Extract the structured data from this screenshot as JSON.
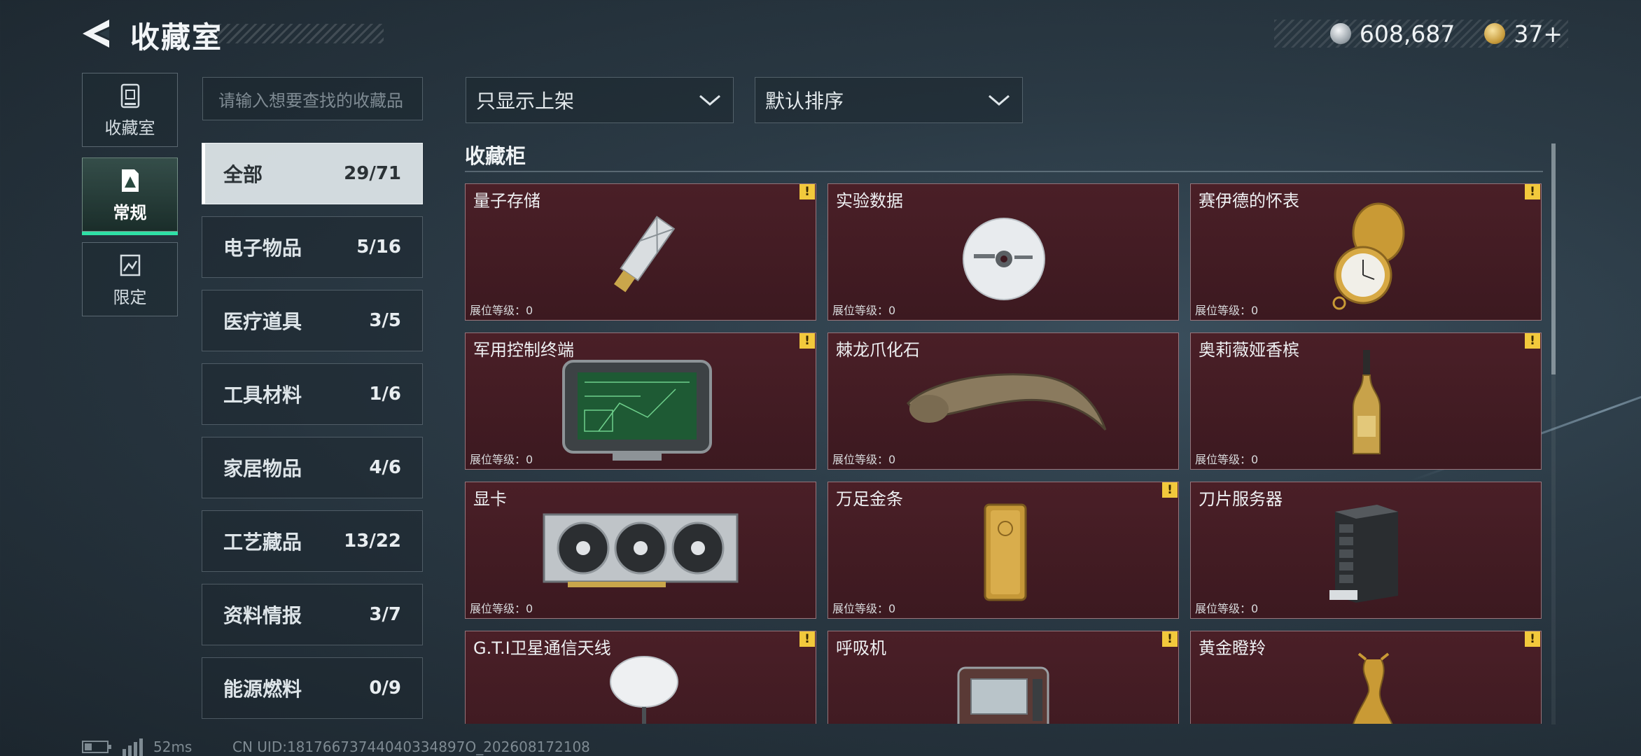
{
  "header": {
    "title": "收藏室"
  },
  "currency": {
    "silver": "608,687",
    "gold": "37+"
  },
  "nav": [
    {
      "label": "收藏室",
      "icon": "collection-room-icon"
    },
    {
      "label": "常规",
      "icon": "regular-icon",
      "active": true
    },
    {
      "label": "限定",
      "icon": "limited-icon"
    }
  ],
  "search": {
    "placeholder": "请输入想要查找的收藏品"
  },
  "filters": {
    "shelf_filter": "只显示上架",
    "sort": "默认排序"
  },
  "categories": [
    {
      "name": "全部",
      "count": "29/71",
      "active": true
    },
    {
      "name": "电子物品",
      "count": "5/16"
    },
    {
      "name": "医疗道具",
      "count": "3/5"
    },
    {
      "name": "工具材料",
      "count": "1/6"
    },
    {
      "name": "家居物品",
      "count": "4/6"
    },
    {
      "name": "工艺藏品",
      "count": "13/22"
    },
    {
      "name": "资料情报",
      "count": "3/7"
    },
    {
      "name": "能源燃料",
      "count": "0/9"
    }
  ],
  "cabinet": {
    "title": "收藏柜",
    "items": [
      {
        "name": "量子存储",
        "level": "展位等级：0",
        "warn": "!",
        "icon": "usb-storage-icon"
      },
      {
        "name": "实验数据",
        "level": "展位等级：0",
        "warn": "",
        "icon": "disc-icon"
      },
      {
        "name": "赛伊德的怀表",
        "level": "展位等级：0",
        "warn": "!",
        "icon": "pocket-watch-icon"
      },
      {
        "name": "军用控制终端",
        "level": "展位等级：0",
        "warn": "!",
        "icon": "control-terminal-icon"
      },
      {
        "name": "棘龙爪化石",
        "level": "展位等级：0",
        "warn": "",
        "icon": "claw-fossil-icon"
      },
      {
        "name": "奥莉薇娅香槟",
        "level": "展位等级：0",
        "warn": "!",
        "icon": "champagne-icon"
      },
      {
        "name": "显卡",
        "level": "展位等级：0",
        "warn": "",
        "icon": "graphics-card-icon"
      },
      {
        "name": "万足金条",
        "level": "展位等级：0",
        "warn": "!",
        "icon": "gold-bar-icon"
      },
      {
        "name": "刀片服务器",
        "level": "展位等级：0",
        "warn": "",
        "icon": "blade-server-icon"
      },
      {
        "name": "G.T.I卫星通信天线",
        "level": "",
        "warn": "!",
        "icon": "satellite-antenna-icon"
      },
      {
        "name": "呼吸机",
        "level": "",
        "warn": "!",
        "icon": "ventilator-icon"
      },
      {
        "name": "黄金瞪羚",
        "level": "",
        "warn": "!",
        "icon": "golden-gazelle-icon"
      }
    ]
  },
  "status": {
    "ping": "52ms",
    "uid": "CN UID:18176673744040334897O_202608172108"
  }
}
